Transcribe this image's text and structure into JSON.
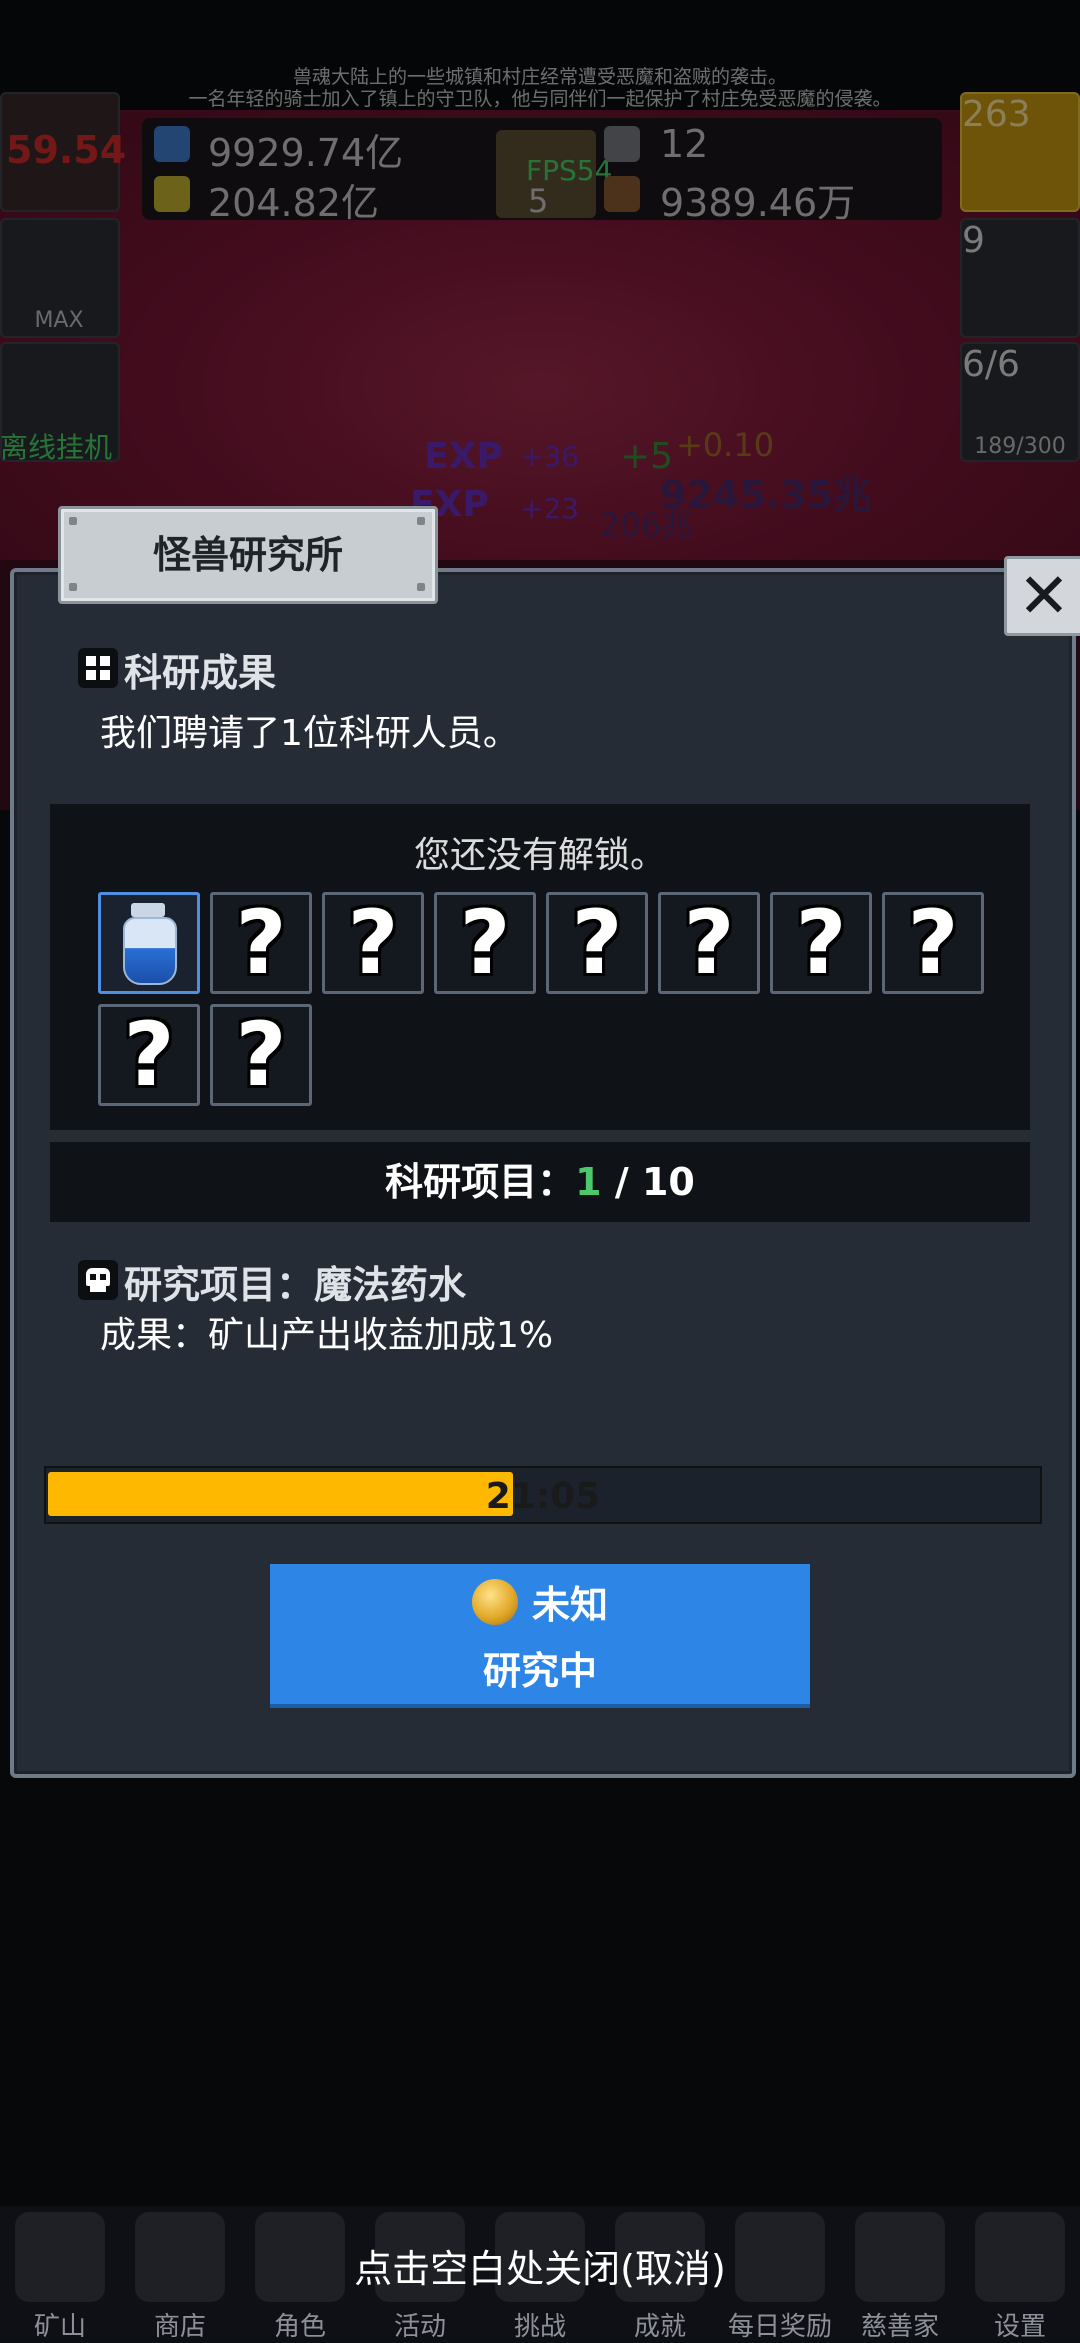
{
  "story_text": [
    "兽魂大陆上的一些城镇和村庄经常遭受恶魔和盗贼的袭击。",
    "一名年轻的骑士加入了镇上的守卫队，他与同伴们一起保护了村庄免受恶魔的侵袭。"
  ],
  "resources": {
    "blue_potion": "9929.74亿",
    "yellow_potion": "204.82亿",
    "stone": "12",
    "meat": "9389.46万",
    "fps": "FPS54",
    "book_count": "5"
  },
  "side_left": {
    "torch_value": "59.54",
    "bread_label": "MAX",
    "offline_label": "离线挂机"
  },
  "side_right": {
    "potion_count": "263",
    "chest_count": "9",
    "slime_count": "6/6",
    "slime_sub": "189/300"
  },
  "battle_floaters": [
    "EXP",
    "EXP",
    "+36",
    "+23",
    "+5",
    "+0.10",
    "9245.35兆",
    "206兆"
  ],
  "dialog": {
    "title": "怪兽研究所",
    "close_icon": "close-icon",
    "result_header": "科研成果",
    "result_text": "我们聘请了1位科研人员。",
    "locked_status": "您还没有解锁。",
    "slots": [
      {
        "state": "unlocked",
        "icon": "blue-potion-icon"
      },
      {
        "state": "locked",
        "glyph": "?"
      },
      {
        "state": "locked",
        "glyph": "?"
      },
      {
        "state": "locked",
        "glyph": "?"
      },
      {
        "state": "locked",
        "glyph": "?"
      },
      {
        "state": "locked",
        "glyph": "?"
      },
      {
        "state": "locked",
        "glyph": "?"
      },
      {
        "state": "locked",
        "glyph": "?"
      },
      {
        "state": "locked",
        "glyph": "?"
      },
      {
        "state": "locked",
        "glyph": "?"
      }
    ],
    "project_count_label": "科研项目：",
    "project_count_done": "1",
    "project_count_sep": " / ",
    "project_count_total": "10",
    "project_header": "研究项目：魔法药水",
    "project_effect": "成果：矿山产出收益加成1%",
    "progress_time": "21:05",
    "progress_fraction": 0.47,
    "cost_label": "未知",
    "button_label": "研究中"
  },
  "close_hint": "点击空白处关闭(取消)",
  "nav": [
    "矿山",
    "商店",
    "角色",
    "活动",
    "挑战",
    "成就",
    "每日奖励",
    "慈善家",
    "设置"
  ],
  "colors": {
    "progress_fill": "#ffb800",
    "button_blue": "#2d86e6",
    "count_green": "#4cc86b"
  }
}
